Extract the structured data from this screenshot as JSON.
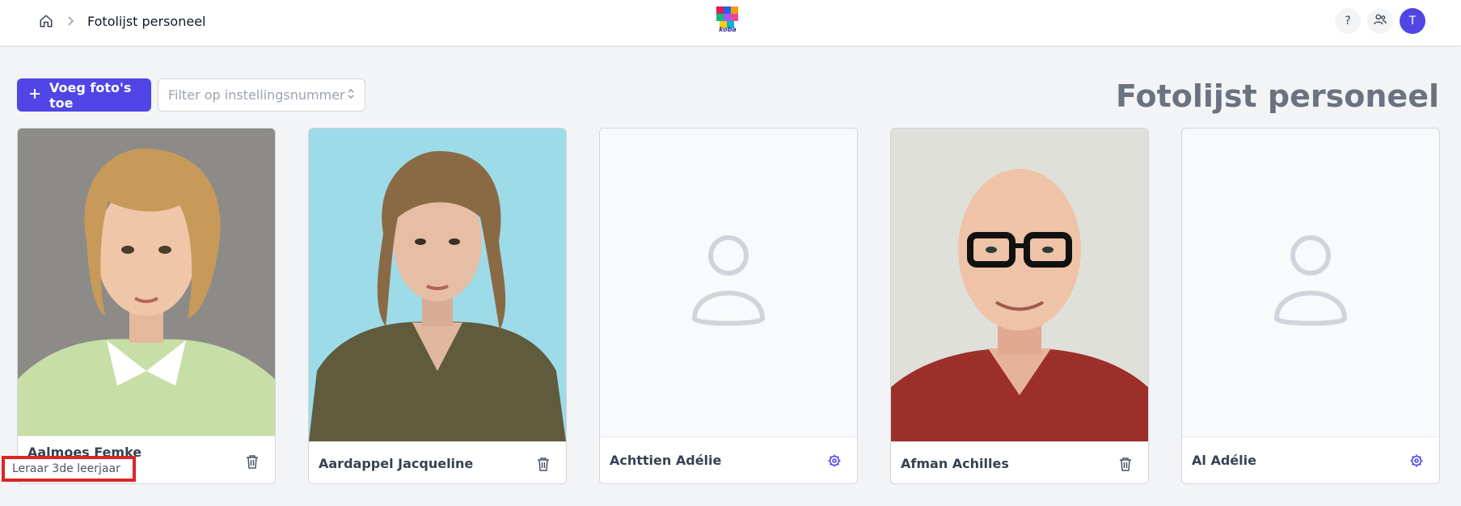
{
  "header": {
    "breadcrumb_title": "Fotolijst personeel",
    "logo_text": "koba",
    "help_label": "?",
    "avatar_initial": "T"
  },
  "toolbar": {
    "add_label": "Voeg foto's toe",
    "filter_placeholder": "Filter op instellingsnummer"
  },
  "page": {
    "title": "Fotolijst personeel"
  },
  "colors": {
    "accent": "#4f46e5",
    "highlight": "#dc2626"
  },
  "cards": [
    {
      "name": "Aalmoes Femke",
      "role": "Leraar 3de leerjaar",
      "has_photo": true,
      "action_icon": "trash-icon"
    },
    {
      "name": "Aardappel Jacqueline",
      "has_photo": true,
      "action_icon": "trash-icon"
    },
    {
      "name": "Achttien Adélie",
      "has_photo": false,
      "action_icon": "gear-icon"
    },
    {
      "name": "Afman Achilles",
      "has_photo": true,
      "action_icon": "trash-icon"
    },
    {
      "name": "Al Adélie",
      "has_photo": false,
      "action_icon": "gear-icon"
    }
  ]
}
